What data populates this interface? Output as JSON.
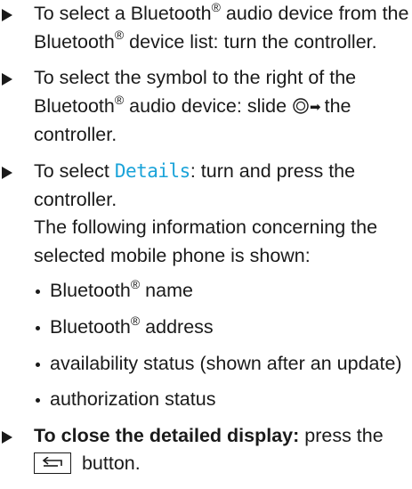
{
  "steps": [
    {
      "text_a": "To select a Bluetooth",
      "reg_a": "®",
      "text_b": " audio device from the Bluetooth",
      "reg_b": "®",
      "text_c": " device list: turn the controller."
    },
    {
      "text_a": "To select the symbol to the right of the Bluetooth",
      "reg_a": "®",
      "text_b": " audio device: slide ",
      "text_c": "the controller.",
      "icon": "controller-slide-right-icon"
    },
    {
      "text_a": "To select ",
      "menu_item": "Details",
      "text_b": ": turn and press the controller.",
      "info_line": "The following information concerning the selected mobile phone is shown:",
      "bullets": [
        {
          "text": "Bluetooth",
          "reg": "®",
          "suffix": " name"
        },
        {
          "text": "Bluetooth",
          "reg": "®",
          "suffix": " address"
        },
        {
          "text": "availability status (shown after an update)",
          "reg": "",
          "suffix": ""
        },
        {
          "text": "authorization status",
          "reg": "",
          "suffix": ""
        }
      ]
    },
    {
      "bold_text": "To close the detailed display:",
      "text_a": " press the ",
      "text_b": " button.",
      "icon": "back-button-icon"
    }
  ],
  "colors": {
    "text": "#1a1a1a",
    "menu_item": "#1aa3d9"
  }
}
